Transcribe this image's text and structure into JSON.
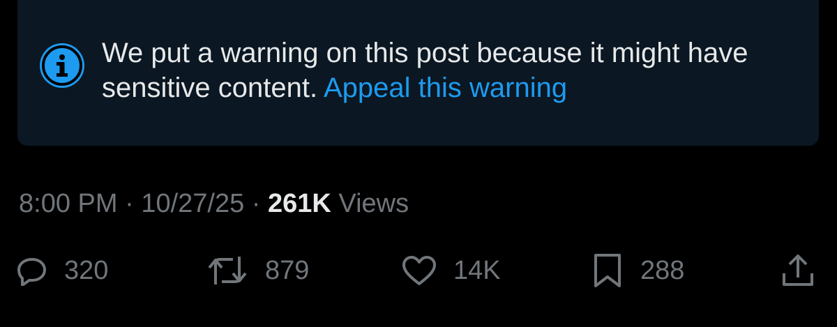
{
  "warning": {
    "text": "We put a warning on this post because it might have sensitive content.",
    "link": "Appeal this warning",
    "icon": "info-icon"
  },
  "meta": {
    "time": "8:00 PM",
    "separator": "·",
    "date": "10/27/25",
    "views_count": "261K",
    "views_label": "Views"
  },
  "actions": {
    "reply": {
      "icon": "reply-icon",
      "count": "320"
    },
    "repost": {
      "icon": "repost-icon",
      "count": "879"
    },
    "like": {
      "icon": "heart-icon",
      "count": "14K"
    },
    "bookmark": {
      "icon": "bookmark-icon",
      "count": "288"
    },
    "share": {
      "icon": "share-icon"
    }
  },
  "colors": {
    "background": "#000000",
    "warning_box": "#0b1722",
    "accent": "#1d9bf0",
    "text_primary": "#e7e9ea",
    "text_secondary": "#71767b"
  }
}
